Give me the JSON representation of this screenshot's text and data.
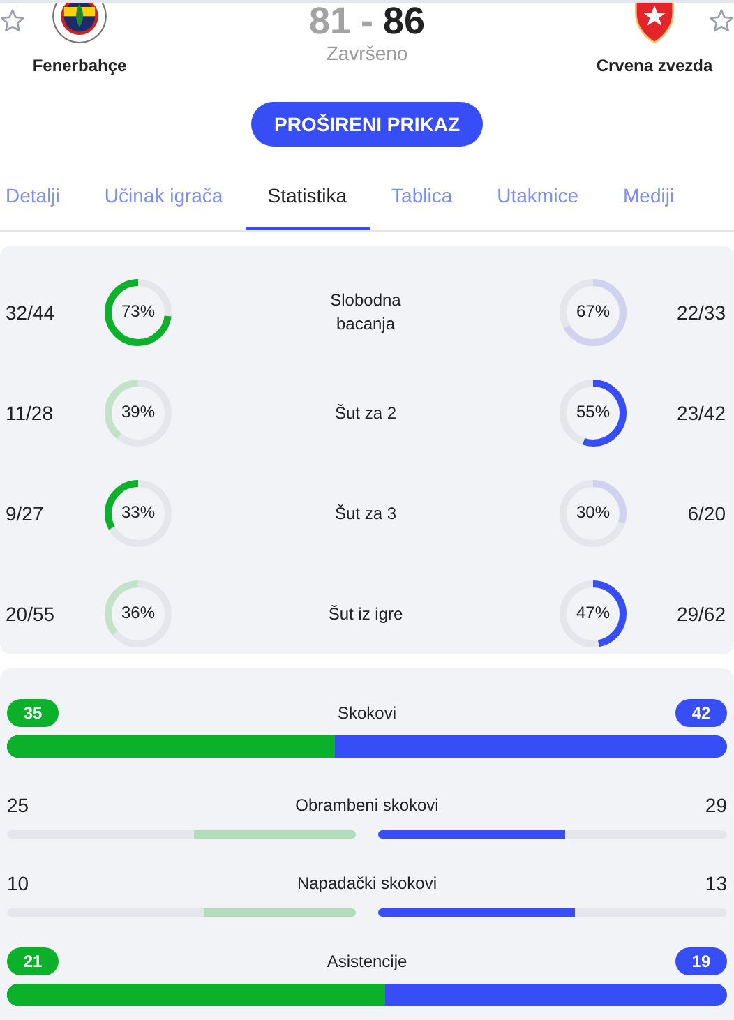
{
  "header": {
    "home": {
      "name": "Fenerbahçe",
      "score": "81"
    },
    "away": {
      "name": "Crvena zvezda",
      "score": "86"
    },
    "separator": "-",
    "status": "Završeno"
  },
  "expand_button": "PROŠIRENI PRIKAZ",
  "tabs": [
    {
      "label": "Detalji",
      "selected": false
    },
    {
      "label": "Učinak igrača",
      "selected": false
    },
    {
      "label": "Statistika",
      "selected": true
    },
    {
      "label": "Tablica",
      "selected": false
    },
    {
      "label": "Utakmice",
      "selected": false
    },
    {
      "label": "Mediji",
      "selected": false
    }
  ],
  "shooting": [
    {
      "label": "Slobodna bacanja",
      "home": {
        "made": "32/44",
        "percent": "73%",
        "leading": true
      },
      "away": {
        "made": "22/33",
        "percent": "67%",
        "leading": false
      }
    },
    {
      "label": "Šut za 2",
      "home": {
        "made": "11/28",
        "percent": "39%",
        "leading": false
      },
      "away": {
        "made": "23/42",
        "percent": "55%",
        "leading": true
      }
    },
    {
      "label": "Šut za 3",
      "home": {
        "made": "9/27",
        "percent": "33%",
        "leading": true
      },
      "away": {
        "made": "6/20",
        "percent": "30%",
        "leading": false
      }
    },
    {
      "label": "Šut iz igre",
      "home": {
        "made": "20/55",
        "percent": "36%",
        "leading": false
      },
      "away": {
        "made": "29/62",
        "percent": "47%",
        "leading": true
      }
    }
  ],
  "bars": [
    {
      "kind": "split",
      "label": "Skokovi",
      "home": "35",
      "away": "42",
      "level": 0.455
    },
    {
      "kind": "pair",
      "label": "Obrambeni skokovi",
      "home": {
        "value": "25",
        "level": 0.463,
        "leading": false
      },
      "away": {
        "value": "29",
        "level": 0.537,
        "leading": true
      }
    },
    {
      "kind": "pair",
      "label": "Napadački skokovi",
      "home": {
        "value": "10",
        "level": 0.435,
        "leading": false
      },
      "away": {
        "value": "13",
        "level": 0.565,
        "leading": true
      }
    },
    {
      "kind": "split",
      "label": "Asistencije",
      "home": "21",
      "away": "19",
      "level": 0.525
    }
  ]
}
